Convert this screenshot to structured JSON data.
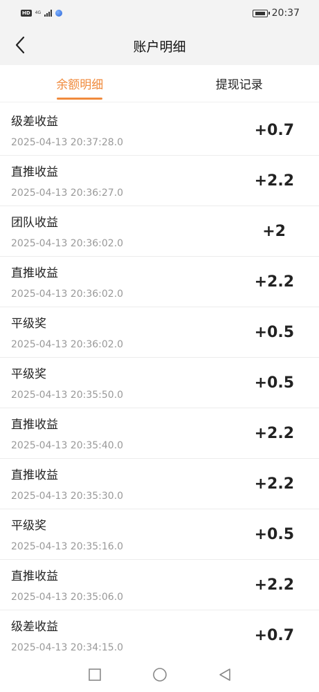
{
  "status_bar": {
    "hd": "HD",
    "network_top": "4G",
    "network_bottom": "⁴⁶",
    "time": "20:37"
  },
  "header": {
    "title": "账户明细"
  },
  "tabs": [
    {
      "label": "余额明细",
      "active": true
    },
    {
      "label": "提现记录",
      "active": false
    }
  ],
  "records": [
    {
      "title": "级差收益",
      "time": "2025-04-13 20:37:28.0",
      "amount": "+0.7"
    },
    {
      "title": "直推收益",
      "time": "2025-04-13 20:36:27.0",
      "amount": "+2.2"
    },
    {
      "title": "团队收益",
      "time": "2025-04-13 20:36:02.0",
      "amount": "+2"
    },
    {
      "title": "直推收益",
      "time": "2025-04-13 20:36:02.0",
      "amount": "+2.2"
    },
    {
      "title": "平级奖",
      "time": "2025-04-13 20:36:02.0",
      "amount": "+0.5"
    },
    {
      "title": "平级奖",
      "time": "2025-04-13 20:35:50.0",
      "amount": "+0.5"
    },
    {
      "title": "直推收益",
      "time": "2025-04-13 20:35:40.0",
      "amount": "+2.2"
    },
    {
      "title": "直推收益",
      "time": "2025-04-13 20:35:30.0",
      "amount": "+2.2"
    },
    {
      "title": "平级奖",
      "time": "2025-04-13 20:35:16.0",
      "amount": "+0.5"
    },
    {
      "title": "直推收益",
      "time": "2025-04-13 20:35:06.0",
      "amount": "+2.2"
    },
    {
      "title": "级差收益",
      "time": "2025-04-13 20:34:15.0",
      "amount": "+0.7"
    }
  ],
  "colors": {
    "accent": "#f08a3c",
    "header_bg": "#f3f3f3"
  },
  "icons": {
    "back": "chevron-left-icon",
    "nav_recent": "square-icon",
    "nav_home": "circle-icon",
    "nav_back": "triangle-back-icon"
  }
}
